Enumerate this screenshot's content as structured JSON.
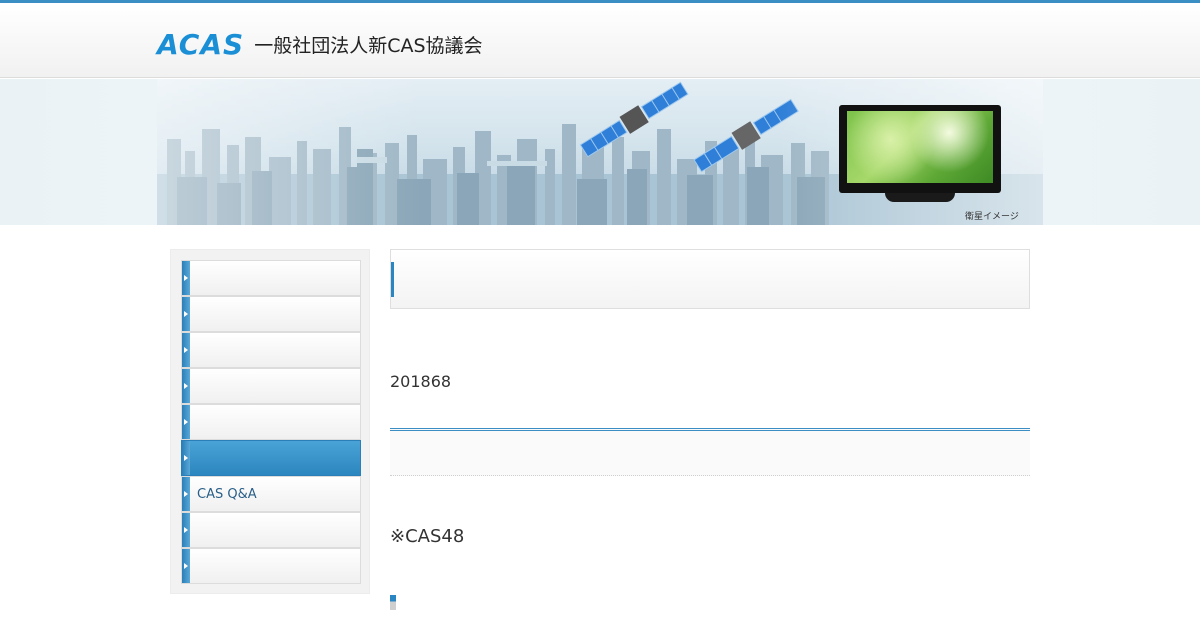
{
  "header": {
    "logo_mark": "ACAS",
    "org_name": "一般社団法人新CAS協議会"
  },
  "hero": {
    "caption": "衛星イメージ",
    "icons": [
      "city-skyline",
      "satellite-icon",
      "satellite-icon",
      "tv-icon"
    ]
  },
  "sidebar": {
    "items": [
      {
        "label": "",
        "active": false
      },
      {
        "label": "",
        "active": false
      },
      {
        "label": "",
        "active": false
      },
      {
        "label": "",
        "active": false
      },
      {
        "label": "",
        "active": false
      },
      {
        "label": "",
        "active": true
      },
      {
        "label": "CAS Q&A",
        "active": false
      },
      {
        "label": "",
        "active": false
      },
      {
        "label": "",
        "active": false
      }
    ]
  },
  "main": {
    "title": "",
    "date": "201868",
    "section_title": "",
    "note": "※CAS48"
  },
  "colors": {
    "accent": "#2a86c2",
    "brand": "#1a8fd6",
    "sidebar_active": "#3a96cc"
  }
}
